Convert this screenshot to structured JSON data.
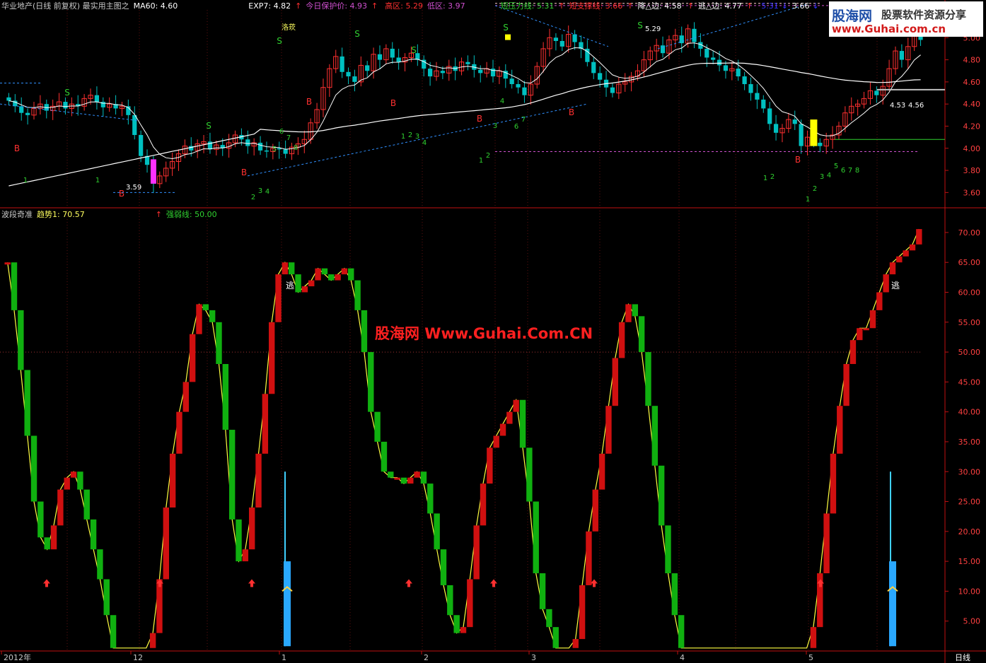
{
  "top_header": [
    {
      "text": "华业地产(日线 前复权) 最实用主图之",
      "color": "#c8c8c8"
    },
    {
      "text": "MA60: 4.60",
      "color": "#ffffff"
    },
    {
      "text": "EXP7: 4.82",
      "color": "#ffffff"
    },
    {
      "text": "↑",
      "color": "#ff3030"
    },
    {
      "text": "今日保护价: 4.93",
      "color": "#d050d0"
    },
    {
      "text": "↑",
      "color": "#ff3030"
    },
    {
      "text": "高区: 5.29",
      "color": "#ff3030"
    },
    {
      "text": "低区: 3.97",
      "color": "#d050d0"
    },
    {
      "text": "短压力线: 5.31",
      "color": "#30d030"
    },
    {
      "text": "↑",
      "color": "#ff3030"
    },
    {
      "text": "短支撑线: 3.66",
      "color": "#ff3030"
    },
    {
      "text": "↑",
      "color": "#ff3030"
    },
    {
      "text": "降△边: 4.58",
      "color": "#ffffff"
    },
    {
      "text": "↑",
      "color": "#ff3030"
    },
    {
      "text": "逃△边: 4.77",
      "color": "#ffffff"
    },
    {
      "text": "↑",
      "color": "#ff3030"
    },
    {
      "text": "5.31",
      "color": "#3030ff"
    },
    {
      "text": "↓",
      "color": "#3030ff"
    },
    {
      "text": "3.66",
      "color": "#ffffff"
    },
    {
      "text": "↓",
      "color": "#3030ff"
    }
  ],
  "watermark": {
    "brand": "股海网",
    "slogan": "股票软件资源分享",
    "url": "www.Guhai.com.cn"
  },
  "center_watermark": "股海网 Www.Guhai.Com.CN",
  "lower_header": [
    {
      "text": "波段奇准",
      "color": "#c8c8c8"
    },
    {
      "text": "趋势1: 70.57",
      "color": "#ffff60"
    },
    {
      "text": "↑",
      "color": "#ff3030"
    },
    {
      "text": "强弱线: 50.00",
      "color": "#30d030"
    }
  ],
  "x_axis": {
    "labels": [
      "2012年",
      "12",
      "1",
      "2",
      "3",
      "4",
      "5"
    ],
    "period": "日线"
  },
  "chart_data": [
    {
      "type": "candlestick",
      "title": "华业地产(日线 前复权) 最实用主图之",
      "ylim": [
        3.5,
        5.2
      ],
      "yticks": [
        3.6,
        3.8,
        4.0,
        4.2,
        4.4,
        4.6,
        4.8,
        5.0
      ],
      "close": [
        4.43,
        4.38,
        4.32,
        4.3,
        4.36,
        4.4,
        4.34,
        4.38,
        4.42,
        4.36,
        4.4,
        4.38,
        4.45,
        4.48,
        4.42,
        4.37,
        4.4,
        4.36,
        4.38,
        4.3,
        4.12,
        3.93,
        3.85,
        3.68,
        3.75,
        3.82,
        3.88,
        3.95,
        4.02,
        3.98,
        4.04,
        4.06,
        3.99,
        4.03,
        4.0,
        4.05,
        4.12,
        4.08,
        4.02,
        4.05,
        3.98,
        3.97,
        4.0,
        3.99,
        3.95,
        4.01,
        4.04,
        4.08,
        4.23,
        4.35,
        4.55,
        4.72,
        4.83,
        4.69,
        4.65,
        4.6,
        4.75,
        4.7,
        4.85,
        4.8,
        4.9,
        4.82,
        4.78,
        4.82,
        4.86,
        4.8,
        4.72,
        4.65,
        4.7,
        4.68,
        4.74,
        4.7,
        4.78,
        4.76,
        4.71,
        4.68,
        4.72,
        4.65,
        4.7,
        4.63,
        4.58,
        4.55,
        4.48,
        4.58,
        4.74,
        4.9,
        5.0,
        4.97,
        4.92,
        5.03,
        4.96,
        4.9,
        4.78,
        4.68,
        4.62,
        4.55,
        4.5,
        4.58,
        4.6,
        4.65,
        4.7,
        4.8,
        4.88,
        4.93,
        4.86,
        4.98,
        5.02,
        4.95,
        5.08,
        4.96,
        4.9,
        4.82,
        4.8,
        4.75,
        4.7,
        4.72,
        4.65,
        4.58,
        4.5,
        4.44,
        4.36,
        4.22,
        4.14,
        4.18,
        4.26,
        4.22,
        4.02,
        4.1,
        4.05,
        4.02,
        4.08,
        4.12,
        4.2,
        4.32,
        4.38,
        4.4,
        4.45,
        4.52,
        4.48,
        4.56,
        4.72,
        4.88,
        4.8,
        4.92,
        5.04,
        4.98
      ],
      "series": [
        {
          "name": "MA60",
          "value": 4.6,
          "color": "#ffffff"
        },
        {
          "name": "EXP7",
          "value": 4.82,
          "color": "#ffffff"
        }
      ],
      "annotations": [
        {
          "text": "S",
          "color": "#30d030"
        },
        {
          "text": "B",
          "color": "#ff3030"
        },
        {
          "text": "3.59",
          "color": "#ffffff"
        },
        {
          "text": "5.29",
          "color": "#ffffff"
        },
        {
          "text": "洛莰",
          "color": "#ffff60"
        },
        {
          "text": "4.53",
          "color": "#ffffff"
        },
        {
          "text": "4.56",
          "color": "#ffffff"
        }
      ],
      "count_labels": [
        "1",
        "2",
        "3",
        "4",
        "5",
        "6",
        "7",
        "8"
      ]
    },
    {
      "type": "bar",
      "title": "波段奇准",
      "ylim": [
        0,
        72
      ],
      "yticks": [
        5,
        10,
        15,
        20,
        25,
        30,
        35,
        40,
        45,
        50,
        55,
        60,
        65,
        70
      ],
      "reference_line": {
        "name": "强弱线",
        "value": 50
      },
      "values": [
        65,
        57,
        47,
        36,
        25,
        19,
        17,
        21,
        27,
        29,
        30,
        27,
        22,
        17,
        12,
        6,
        0.5,
        0.5,
        0.5,
        0.5,
        0.5,
        0.5,
        3,
        12,
        24,
        33,
        40,
        45,
        53,
        58,
        57,
        55,
        48,
        37,
        22,
        15,
        17,
        24,
        33,
        43,
        55,
        63,
        65,
        63,
        60,
        61,
        62,
        64,
        63,
        62,
        63,
        64,
        62,
        57,
        50,
        40,
        35,
        30,
        29,
        29,
        28,
        29,
        30,
        28,
        23,
        17,
        11,
        6,
        3,
        4,
        12,
        21,
        28,
        34,
        36,
        38,
        40,
        42,
        34,
        25,
        13,
        7,
        4,
        0.5,
        0.5,
        0.5,
        2,
        11,
        20,
        27,
        33,
        41,
        49,
        55,
        58,
        56,
        50,
        41,
        31,
        21,
        13,
        6,
        0.5,
        0.5,
        0.5,
        0.5,
        0.5,
        0.5,
        0.5,
        0.5,
        0.5,
        0.5,
        0.5,
        0.5,
        0.5,
        0.5,
        0.5,
        0.5,
        0.5,
        0.5,
        0.5,
        0.5,
        4,
        13,
        23,
        33,
        41,
        48,
        52,
        54,
        54,
        57,
        60,
        63,
        65,
        66,
        67,
        68,
        70.57
      ],
      "last_value": 70.57,
      "markers": [
        {
          "text": "逃",
          "color": "#ffffff"
        },
        {
          "text": "逃",
          "color": "#ffffff"
        }
      ]
    }
  ],
  "colors": {
    "up": "#ff3030",
    "down": "#00c0c0",
    "osc_up": "#d01010",
    "osc_down": "#10b010",
    "grid": "#601010",
    "axis": "#c01010"
  }
}
